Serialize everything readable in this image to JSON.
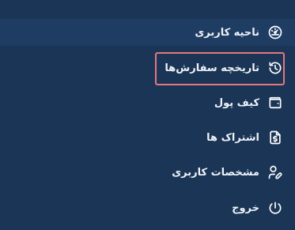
{
  "menu": {
    "items": [
      {
        "label": "ناحیه کاربری",
        "icon": "dashboard-gauge-icon",
        "active": true
      },
      {
        "label": "تاریخچه سفارش‌ها",
        "icon": "history-clock-icon",
        "highlighted": true
      },
      {
        "label": "کیف پول",
        "icon": "wallet-icon"
      },
      {
        "label": "اشتراک ها",
        "icon": "subscription-receipt-icon"
      },
      {
        "label": "مشخصات کاربری",
        "icon": "user-edit-icon"
      },
      {
        "label": "خروج",
        "icon": "power-logout-icon"
      }
    ]
  },
  "colors": {
    "background": "#1b3557",
    "active_band": "#1f3d63",
    "text": "#eef2f7",
    "highlight_border": "#e5777d"
  }
}
